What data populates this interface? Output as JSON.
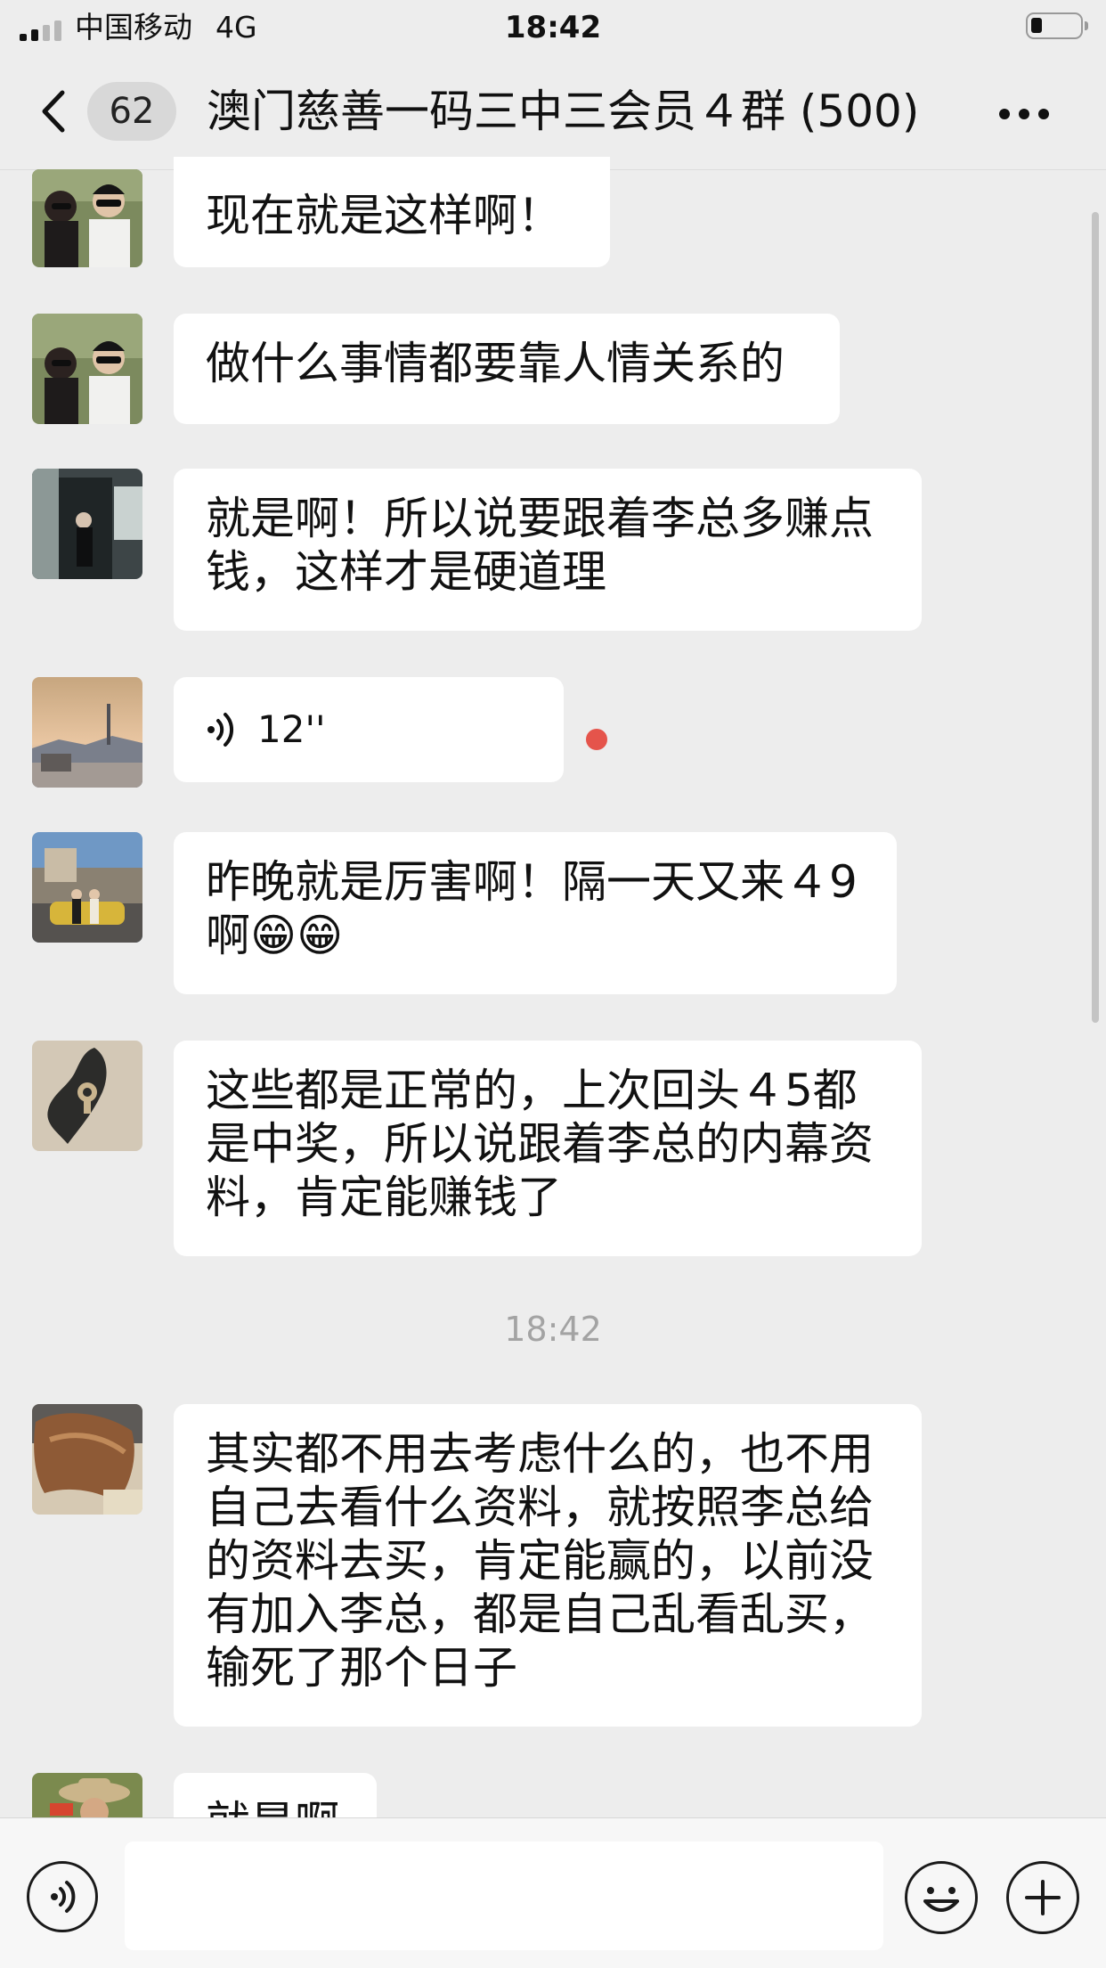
{
  "status_bar": {
    "carrier": "中国移动",
    "network": "4G",
    "time": "18:42",
    "battery_percent": 20
  },
  "nav": {
    "back_icon": "chevron-left-icon",
    "unread_count": "62",
    "title": "澳门慈善一码三中三会员４群 (500)",
    "more_icon": "more-dots-icon"
  },
  "messages": [
    {
      "type": "text",
      "avatar": "couple-photo",
      "text": "现在就是这样啊！"
    },
    {
      "type": "text",
      "avatar": "couple-photo",
      "text": "做什么事情都要靠人情关系的"
    },
    {
      "type": "text",
      "avatar": "doorway-photo",
      "text": "就是啊！所以说要跟着李总多赚点钱，这样才是硬道理"
    },
    {
      "type": "voice",
      "avatar": "sunset-tower-photo",
      "duration": "12''",
      "unplayed": true
    },
    {
      "type": "text",
      "avatar": "street-car-photo",
      "text": "昨晚就是厉害啊！隔一天又来４9啊😁😁"
    },
    {
      "type": "text",
      "avatar": "island-map-photo",
      "text": "这些都是正常的，上次回头４5都是中奖，所以说跟着李总的内幕资料，肯定能赚钱了"
    },
    {
      "type": "time",
      "text": "18:42"
    },
    {
      "type": "text",
      "avatar": "hair-selfie-photo",
      "text": "其实都不用去考虑什么的，也不用自己去看什么资料，就按照李总给的资料去买，肯定能赢的，以前没有加入李总，都是自己乱看乱买，输死了那个日子"
    },
    {
      "type": "text",
      "avatar": "hat-man-photo",
      "text": "就是啊"
    }
  ],
  "input_bar": {
    "voice_icon": "voice-input-icon",
    "emoji_icon": "emoji-icon",
    "plus_icon": "plus-icon",
    "input_value": ""
  }
}
